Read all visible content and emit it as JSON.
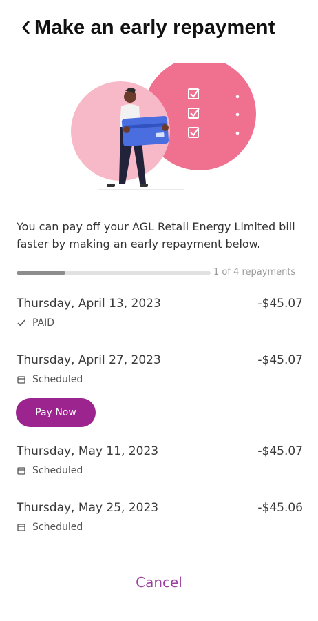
{
  "header": {
    "title": "Make an early repayment",
    "back_icon": "chevron-left-icon"
  },
  "description": "You can pay off your AGL Retail Energy Limited bill faster by making an early repayment below.",
  "progress": {
    "label": "1 of 4 repayments",
    "completed": 1,
    "total": 4
  },
  "repayments": [
    {
      "date": "Thursday, April 13, 2023",
      "amount": "-$45.07",
      "status": "PAID",
      "status_icon": "check-icon"
    },
    {
      "date": "Thursday, April 27, 2023",
      "amount": "-$45.07",
      "status": "Scheduled",
      "status_icon": "calendar-icon"
    },
    {
      "date": "Thursday, May 11, 2023",
      "amount": "-$45.07",
      "status": "Scheduled",
      "status_icon": "calendar-icon"
    },
    {
      "date": "Thursday, May 25, 2023",
      "amount": "-$45.06",
      "status": "Scheduled",
      "status_icon": "calendar-icon"
    }
  ],
  "pay_now_label": "Pay Now",
  "cancel_label": "Cancel",
  "colors": {
    "accent": "#9c248f",
    "cancel_text": "#9c3fa0",
    "circle_light": "#f7b9c8",
    "circle_dark": "#f0708f",
    "card": "#4a6ee0"
  }
}
